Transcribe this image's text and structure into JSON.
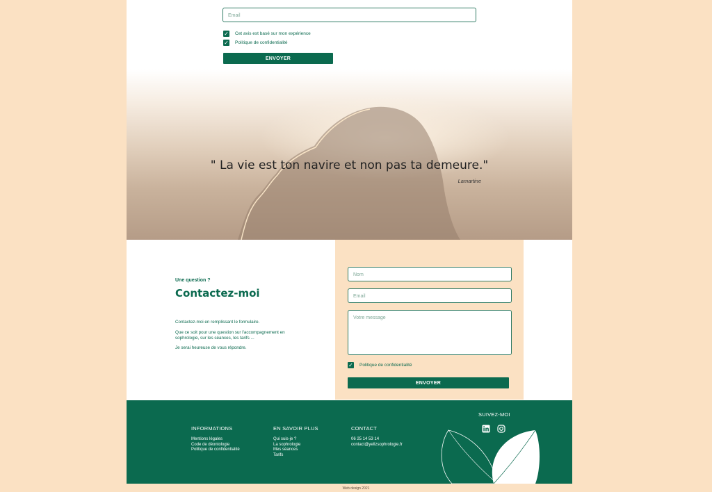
{
  "top_form": {
    "email_placeholder": "Email",
    "checkbox_experience": "Cet avis est basé sur mon expérience",
    "checkbox_privacy": "Politique de confidentialité",
    "submit": "ENVOYER"
  },
  "hero": {
    "quote": "\" La vie est ton navire et non pas ta demeure.\"",
    "author": "Lamartine"
  },
  "contact": {
    "eyebrow": "Une question ?",
    "title": "Contactez-moi",
    "para1": "Contactez-moi en remplissant le formulaire.",
    "para2": "Que ce soit pour une question sur l'accompagnement en sophrologie, sur les séances, les tarifs ...",
    "para3": "Je serai heureuse de vous répondre.",
    "name_placeholder": "Nom",
    "email_placeholder": "Email",
    "message_placeholder": "Votre message",
    "privacy": "Politique de confidentialité",
    "submit": "ENVOYER"
  },
  "footer": {
    "informations": {
      "title": "INFORMATIONS",
      "links": [
        "Mentions légales",
        "Code de déontologie",
        "Politique de confidentialité"
      ]
    },
    "en_savoir_plus": {
      "title": "EN SAVOIR PLUS",
      "links": [
        "Qui suis-je ?",
        "La sophrologie",
        "Mes séances",
        "Tarifs"
      ]
    },
    "contact": {
      "title": "CONTACT",
      "phone": "06 25 14 53 14",
      "email": "contact@yellzsophrologie.fr"
    },
    "follow": "SUIVEZ-MOI",
    "social": [
      "linkedin-icon",
      "instagram-icon"
    ]
  },
  "credit": "Web design 2021",
  "colors": {
    "brand_green": "#0b6a4f",
    "peach": "#fbe1c3"
  }
}
